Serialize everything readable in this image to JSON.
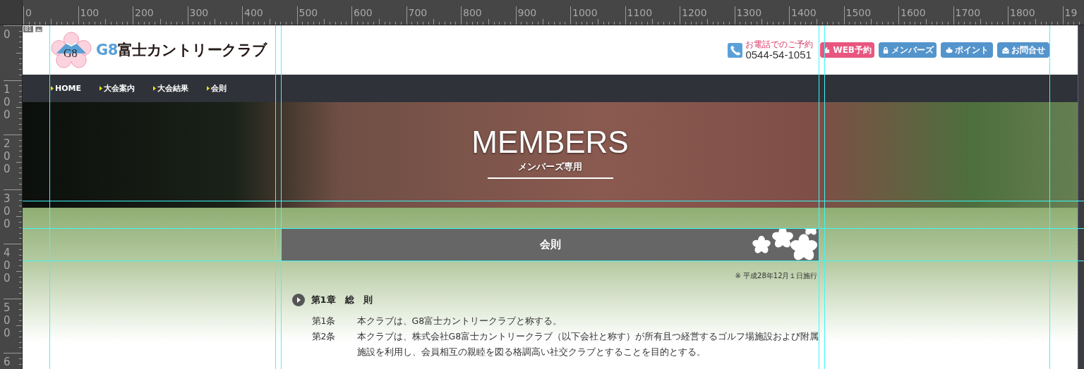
{
  "rulers": {
    "horizontal": [
      "0",
      "100",
      "200",
      "300",
      "400",
      "500",
      "600",
      "700",
      "800",
      "900",
      "1000",
      "1100",
      "1200",
      "1300",
      "1400",
      "1500",
      "1600",
      "1700",
      "1800",
      "19"
    ],
    "vertical": [
      "0",
      "100",
      "200",
      "300",
      "400",
      "500",
      "6"
    ]
  },
  "canvas_badge": {
    "label": "01"
  },
  "header": {
    "logo": {
      "emblem_text": "G8",
      "brand_accent": "G8",
      "brand_name": "富士カントリークラブ"
    },
    "phone": {
      "caption": "お電話でのご予約",
      "number": "0544-54-1051"
    },
    "buttons": [
      {
        "label": "WEB予約",
        "kind": "reserve"
      },
      {
        "label": "メンバーズ",
        "kind": "members"
      },
      {
        "label": "ポイント",
        "kind": "point"
      },
      {
        "label": "お問合せ",
        "kind": "contact"
      }
    ]
  },
  "nav": [
    {
      "label": "HOME"
    },
    {
      "label": "大会案内"
    },
    {
      "label": "大会結果"
    },
    {
      "label": "会則"
    }
  ],
  "hero": {
    "title": "MEMBERS",
    "subtitle": "メンバーズ専用"
  },
  "section": {
    "title": "会則",
    "note": "※ 平成28年12月１日施行",
    "chapters": [
      {
        "title": "第1章　総　則",
        "articles": [
          {
            "number": "第1条",
            "text": "本クラブは、G8富士カントリークラブと称する。"
          },
          {
            "number": "第2条",
            "text": "本クラブは、株式会社G8富士カントリークラブ（以下会社と称す）が所有且つ経営するゴルフ場施設および附属施設を利用し、会員相互の親睦を図る格調高い社交クラブとすることを目的とする。"
          }
        ]
      }
    ]
  }
}
